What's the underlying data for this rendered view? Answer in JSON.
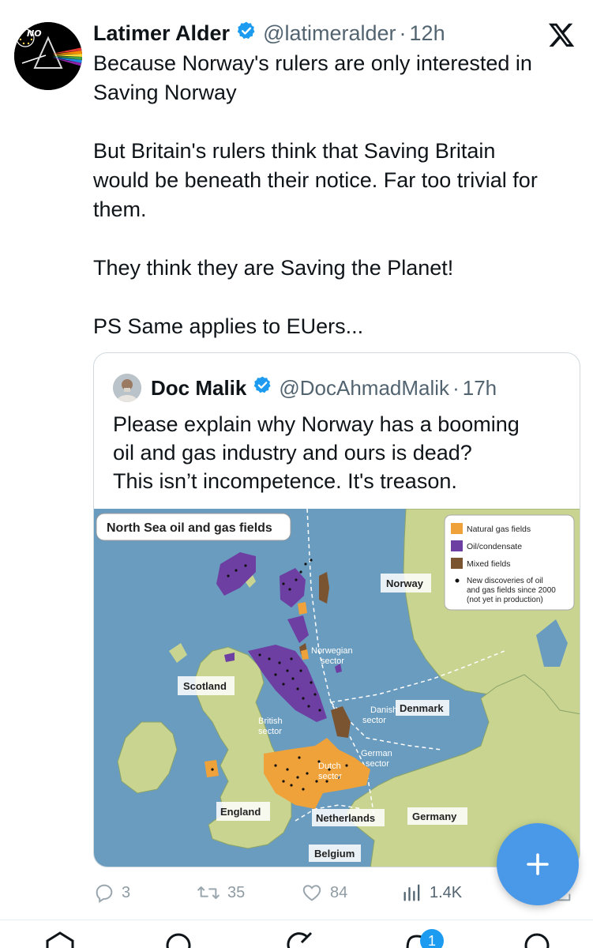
{
  "tweet": {
    "author_name": "Latimer Alder",
    "author_handle": "@latimeralder",
    "separator": "·",
    "time": "12h",
    "avatar_tag": "NO",
    "body": [
      "Because Norway's rulers are  only interested in",
      "Saving Norway",
      "",
      "But Britain's rulers think that Saving Britain",
      "would be  beneath their notice. Far too trivial for",
      "them.",
      "",
      "They think they are Saving the Planet!",
      "",
      "PS Same applies to EUers..."
    ]
  },
  "quote": {
    "author_name": "Doc Malik",
    "author_handle": "@DocAhmadMalik",
    "separator": "·",
    "time": "17h",
    "body": [
      "Please explain why Norway has a booming",
      "oil and gas industry and ours is dead?",
      "This isn’t incompetence. It's treason."
    ],
    "map": {
      "title": "North Sea oil and gas fields",
      "legend": {
        "natural_gas": "Natural gas fields",
        "oil": "Oil/condensate",
        "mixed": "Mixed fields",
        "new_1": "New discoveries of oil",
        "new_2": "and gas fields since 2000",
        "new_3": "(not yet in production)"
      },
      "labels": {
        "norway": "Norway",
        "scotland": "Scotland",
        "england": "England",
        "denmark": "Denmark",
        "germany": "Germany",
        "netherlands": "Netherlands",
        "belgium": "Belgium",
        "norwegian_1": "Norwegian",
        "norwegian_2": "sector",
        "british_1": "British",
        "british_2": "sector",
        "danish_1": "Danish",
        "danish_2": "sector",
        "german_1": "German",
        "german_2": "sector",
        "dutch_1": "Dutch",
        "dutch_2": "sector"
      },
      "colors": {
        "sea": "#6a9cbf",
        "land": "#c8d48f",
        "gas": "#f0a23a",
        "oil": "#6e3fa3",
        "mixed": "#7a5330"
      }
    }
  },
  "actions": {
    "replies": "3",
    "reposts": "35",
    "likes": "84",
    "views": "1.4K"
  },
  "nav": {
    "notifications_badge": "1"
  },
  "colors": {
    "accent": "#1d9bf0",
    "fab": "#4a99e9",
    "text": "#0f1419",
    "muted": "#536471"
  }
}
